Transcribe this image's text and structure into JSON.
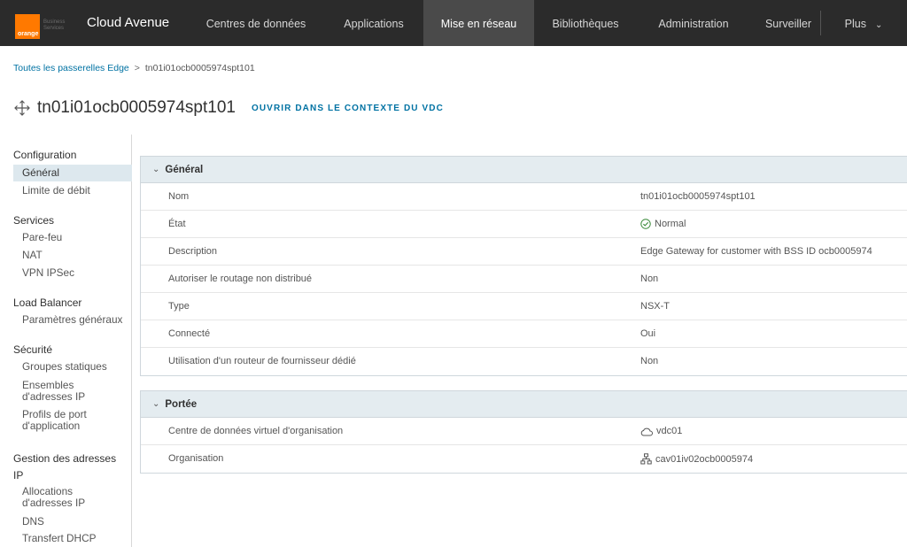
{
  "header": {
    "logo_word": "orange",
    "logo_sub_1": "Business",
    "logo_sub_2": "Services",
    "brand": "Cloud Avenue",
    "nav": [
      {
        "label": "Centres de données"
      },
      {
        "label": "Applications"
      },
      {
        "label": "Mise en réseau",
        "active": true
      },
      {
        "label": "Bibliothèques"
      },
      {
        "label": "Administration"
      },
      {
        "label": "Surveiller"
      },
      {
        "label": "Plus"
      }
    ],
    "accent_color": "#ff7900"
  },
  "breadcrumb": {
    "link": "Toutes les passerelles Edge",
    "separator": ">",
    "current": "tn01i01ocb0005974spt101"
  },
  "page": {
    "title": "tn01i01ocb0005974spt101",
    "context_link": "OUVRIR DANS LE CONTEXTE DU VDC",
    "title_icon": "edge-gateway-icon"
  },
  "sidebar": {
    "groups": [
      {
        "label": "Configuration"
      },
      {
        "label": "Services"
      },
      {
        "label": "Load Balancer"
      },
      {
        "label": "Sécurité"
      },
      {
        "label": "Gestion des adresses IP"
      }
    ],
    "items": [
      {
        "label": "Général",
        "active": true
      },
      {
        "label": "Limite de débit"
      },
      {
        "label": "Pare-feu"
      },
      {
        "label": "NAT"
      },
      {
        "label": "VPN IPSec"
      },
      {
        "label": "Paramètres généraux"
      },
      {
        "label": "Groupes statiques"
      },
      {
        "label": "Ensembles d'adresses IP"
      },
      {
        "label": "Profils de port d'application"
      },
      {
        "label": "Allocations d'adresses IP"
      },
      {
        "label": "DNS"
      },
      {
        "label": "Transfert DHCP"
      }
    ]
  },
  "general": {
    "heading": "Général",
    "rows": [
      {
        "key": "Nom",
        "value": "tn01i01ocb0005974spt101"
      },
      {
        "key": "État",
        "value": "Normal",
        "icon": "check-circle-icon"
      },
      {
        "key": "Description",
        "value": "Edge Gateway for customer with BSS ID ocb0005974"
      },
      {
        "key": "Autoriser le routage non distribué",
        "value": "Non"
      },
      {
        "key": "Type",
        "value": "NSX-T"
      },
      {
        "key": "Connecté",
        "value": "Oui"
      },
      {
        "key": "Utilisation d'un routeur de fournisseur dédié",
        "value": "Non"
      }
    ]
  },
  "scope": {
    "heading": "Portée",
    "rows": [
      {
        "key": "Centre de données virtuel d'organisation",
        "value": "vdc01",
        "icon": "cloud-icon"
      },
      {
        "key": "Organisation",
        "value": "cav01iv02ocb0005974",
        "icon": "org-tree-icon"
      }
    ]
  }
}
